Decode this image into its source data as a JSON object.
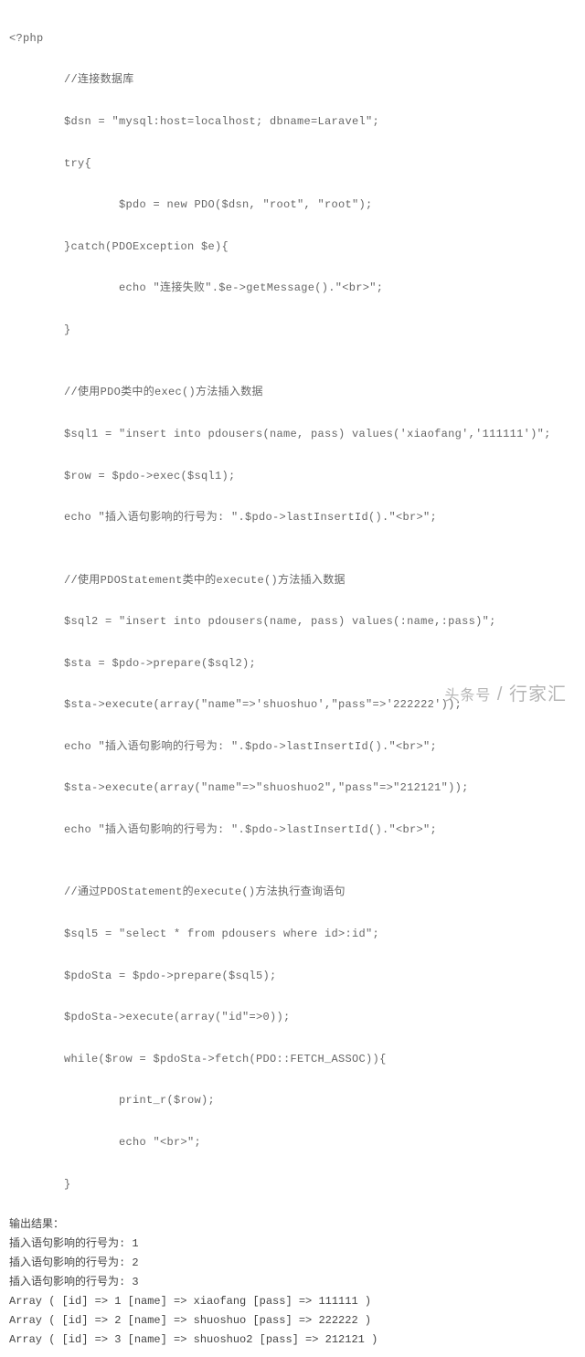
{
  "code": {
    "l01": "<?php",
    "l02": "        //连接数据库",
    "l03": "        $dsn = \"mysql:host=localhost; dbname=Laravel\";",
    "l04": "        try{",
    "l05": "                $pdo = new PDO($dsn, \"root\", \"root\");",
    "l06": "        }catch(PDOException $e){",
    "l07": "                echo \"连接失败\".$e->getMessage().\"<br>\";",
    "l08": "        }",
    "l09": "",
    "l10": "        //使用PDO类中的exec()方法插入数据",
    "l11": "        $sql1 = \"insert into pdousers(name, pass) values('xiaofang','111111')\";",
    "l12": "        $row = $pdo->exec($sql1);",
    "l13": "        echo \"插入语句影响的行号为: \".$pdo->lastInsertId().\"<br>\";",
    "l14": "",
    "l15": "        //使用PDOStatement类中的execute()方法插入数据",
    "l16": "        $sql2 = \"insert into pdousers(name, pass) values(:name,:pass)\";",
    "l17": "        $sta = $pdo->prepare($sql2);",
    "l18": "        $sta->execute(array(\"name\"=>'shuoshuo',\"pass\"=>'222222'));",
    "l19": "        echo \"插入语句影响的行号为: \".$pdo->lastInsertId().\"<br>\";",
    "l20": "        $sta->execute(array(\"name\"=>\"shuoshuo2\",\"pass\"=>\"212121\"));",
    "l21": "        echo \"插入语句影响的行号为: \".$pdo->lastInsertId().\"<br>\";",
    "l22": "",
    "l23": "        //通过PDOStatement的execute()方法执行查询语句",
    "l24": "        $sql5 = \"select * from pdousers where id>:id\";",
    "l25": "        $pdoSta = $pdo->prepare($sql5);",
    "l26": "        $pdoSta->execute(array(\"id\"=>0));",
    "l27": "        while($row = $pdoSta->fetch(PDO::FETCH_ASSOC)){",
    "l28": "                print_r($row);",
    "l29": "                echo \"<br>\";",
    "l30": "        }"
  },
  "output": {
    "title": "输出结果：",
    "r1": "插入语句影响的行号为: 1",
    "r2": "插入语句影响的行号为: 2",
    "r3": "插入语句影响的行号为: 3",
    "a1": "Array ( [id] => 1 [name] => xiaofang [pass] => 111111 )",
    "a2": "Array ( [id] => 2 [name] => shuoshuo [pass] => 222222 )",
    "a3": "Array ( [id] => 3 [name] => shuoshuo2 [pass] => 212121 )"
  },
  "watermark": {
    "left": "头条号",
    "sep": " / ",
    "right": "行家汇"
  }
}
